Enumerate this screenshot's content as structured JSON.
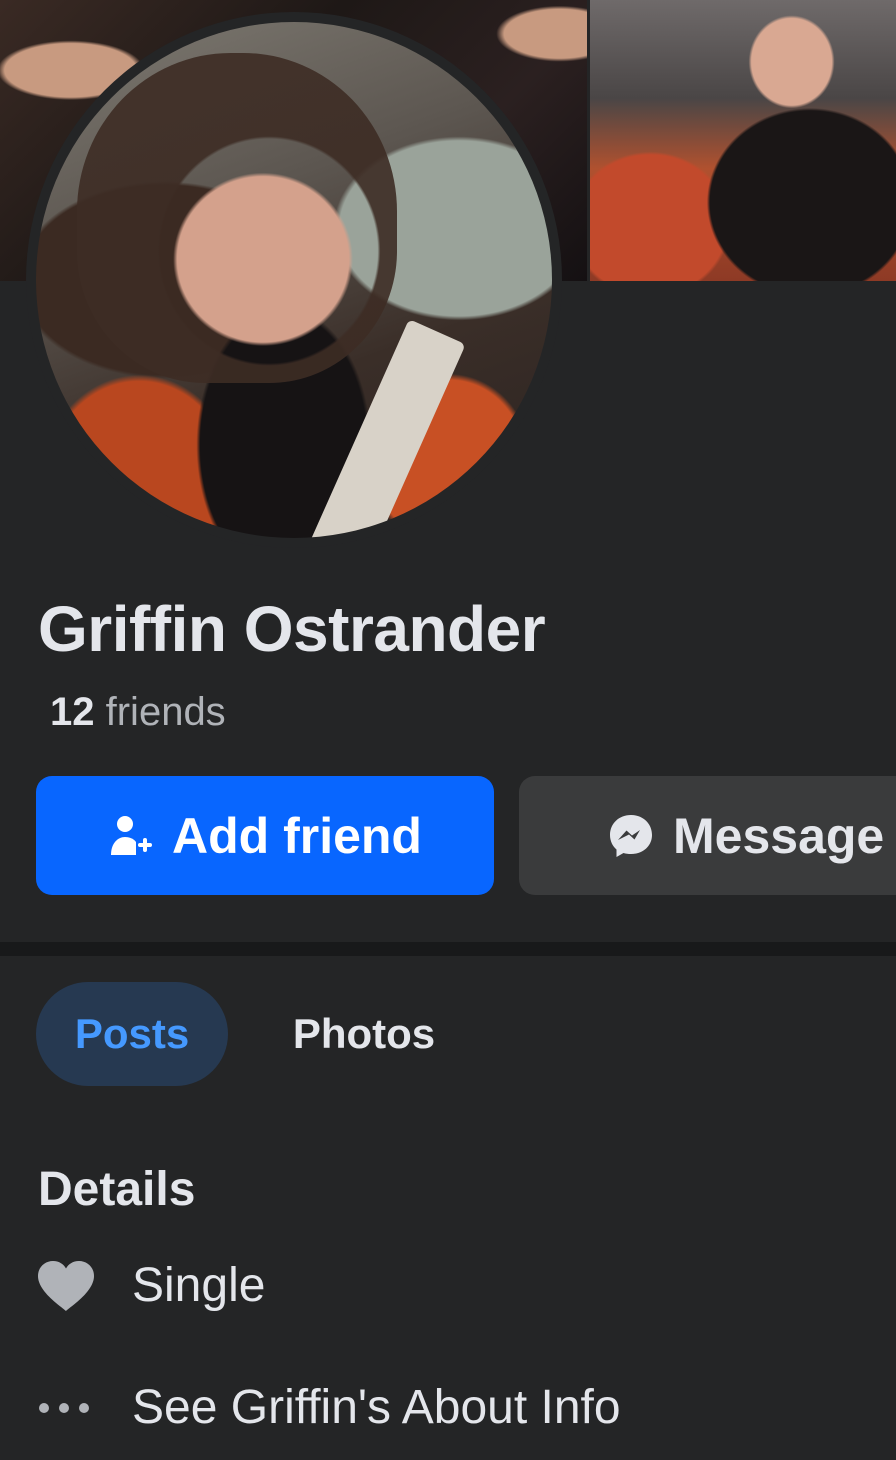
{
  "profile": {
    "name": "Griffin Ostrander",
    "friends_count": "12",
    "friends_label": "friends"
  },
  "actions": {
    "add_friend_label": "Add friend",
    "message_label": "Message"
  },
  "tabs": [
    {
      "label": "Posts",
      "active": true
    },
    {
      "label": "Photos",
      "active": false
    }
  ],
  "details": {
    "title": "Details",
    "items": [
      {
        "icon": "heart-icon",
        "text": "Single"
      },
      {
        "icon": "more-dots-icon",
        "text": "See Griffin's About Info"
      }
    ]
  },
  "colors": {
    "primary": "#0866ff",
    "background": "#242526",
    "active_tab_bg": "#263951",
    "active_tab_text": "#4599ff",
    "secondary_button": "#3a3b3c"
  }
}
